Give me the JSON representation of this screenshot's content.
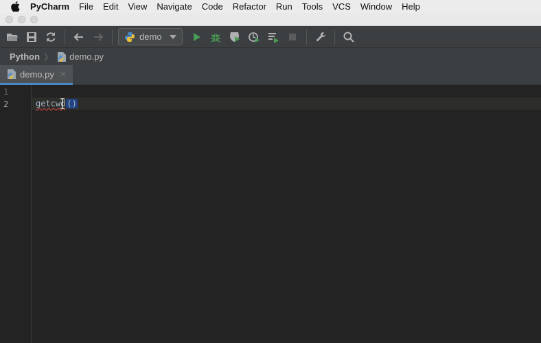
{
  "menubar": {
    "apple_icon": "apple-icon",
    "app_name": "PyCharm",
    "items": [
      "File",
      "Edit",
      "View",
      "Navigate",
      "Code",
      "Refactor",
      "Run",
      "Tools",
      "VCS",
      "Window",
      "Help"
    ]
  },
  "toolbar": {
    "icons": [
      "open-folder-icon",
      "save-icon",
      "sync-icon",
      "back-arrow-icon",
      "forward-arrow-icon",
      "run-icon",
      "debug-icon",
      "coverage-icon",
      "profile-icon",
      "concurrency-icon",
      "stop-icon",
      "settings-wrench-icon",
      "search-icon"
    ],
    "run_config": "demo"
  },
  "breadcrumb": {
    "root": "Python",
    "file": "demo.py"
  },
  "tab": {
    "label": "demo.py",
    "close": "✕"
  },
  "editor": {
    "line_numbers": [
      "1",
      "2"
    ],
    "code_function": "getcwd",
    "code_parens": "()"
  },
  "colors": {
    "accent": "#4a88c7",
    "run_green": "#499c54",
    "selection": "#214283",
    "error_underline": "#bc3f3c"
  }
}
